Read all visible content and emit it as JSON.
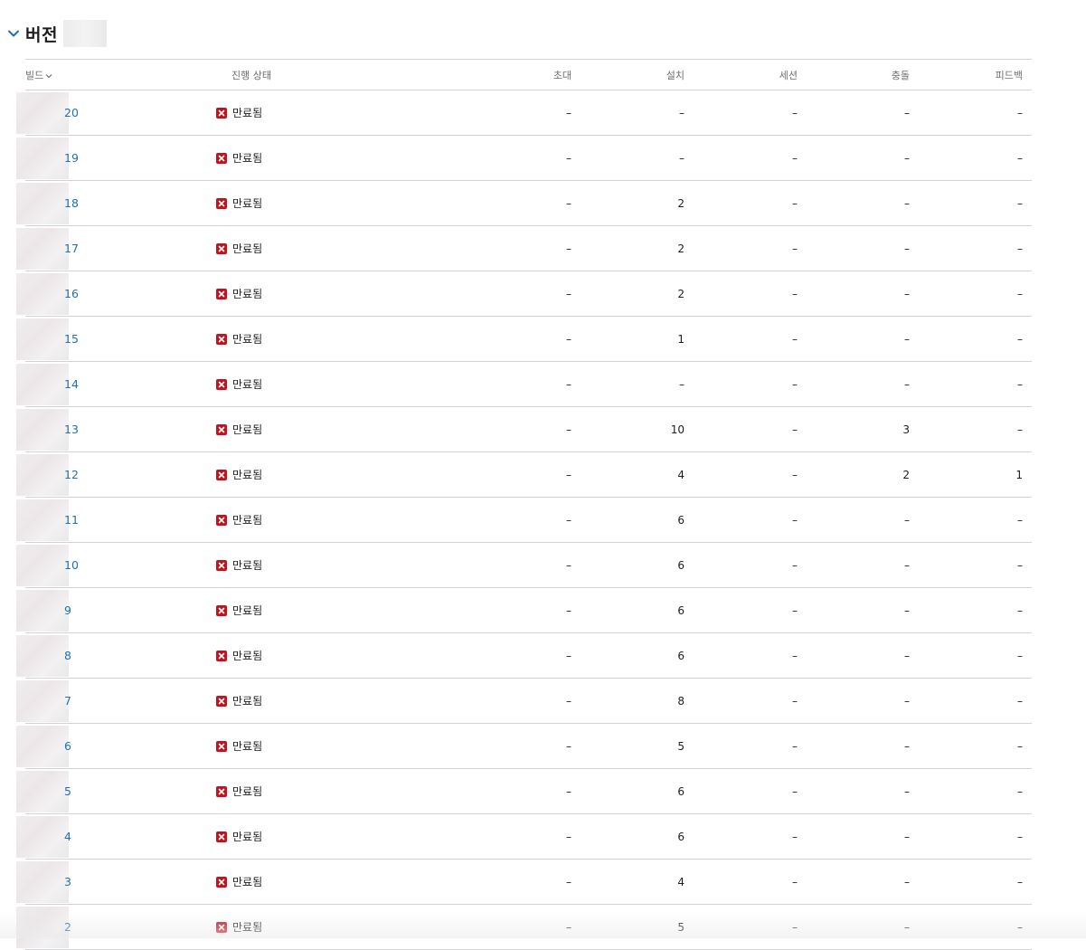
{
  "section": {
    "title": "버전"
  },
  "columns": {
    "build": "빌드",
    "status": "진행 상태",
    "invites": "초대",
    "installs": "설치",
    "sessions": "세션",
    "crashes": "충돌",
    "feedback": "피드백"
  },
  "rows": [
    {
      "build": "20",
      "status": "만료됨",
      "invites": "–",
      "installs": "–",
      "sessions": "–",
      "crashes": "–",
      "feedback": "–"
    },
    {
      "build": "19",
      "status": "만료됨",
      "invites": "–",
      "installs": "–",
      "sessions": "–",
      "crashes": "–",
      "feedback": "–"
    },
    {
      "build": "18",
      "status": "만료됨",
      "invites": "–",
      "installs": "2",
      "sessions": "–",
      "crashes": "–",
      "feedback": "–"
    },
    {
      "build": "17",
      "status": "만료됨",
      "invites": "–",
      "installs": "2",
      "sessions": "–",
      "crashes": "–",
      "feedback": "–"
    },
    {
      "build": "16",
      "status": "만료됨",
      "invites": "–",
      "installs": "2",
      "sessions": "–",
      "crashes": "–",
      "feedback": "–"
    },
    {
      "build": "15",
      "status": "만료됨",
      "invites": "–",
      "installs": "1",
      "sessions": "–",
      "crashes": "–",
      "feedback": "–"
    },
    {
      "build": "14",
      "status": "만료됨",
      "invites": "–",
      "installs": "–",
      "sessions": "–",
      "crashes": "–",
      "feedback": "–"
    },
    {
      "build": "13",
      "status": "만료됨",
      "invites": "–",
      "installs": "10",
      "sessions": "–",
      "crashes": "3",
      "feedback": "–"
    },
    {
      "build": "12",
      "status": "만료됨",
      "invites": "–",
      "installs": "4",
      "sessions": "–",
      "crashes": "2",
      "feedback": "1"
    },
    {
      "build": "11",
      "status": "만료됨",
      "invites": "–",
      "installs": "6",
      "sessions": "–",
      "crashes": "–",
      "feedback": "–"
    },
    {
      "build": "10",
      "status": "만료됨",
      "invites": "–",
      "installs": "6",
      "sessions": "–",
      "crashes": "–",
      "feedback": "–"
    },
    {
      "build": "9",
      "status": "만료됨",
      "invites": "–",
      "installs": "6",
      "sessions": "–",
      "crashes": "–",
      "feedback": "–"
    },
    {
      "build": "8",
      "status": "만료됨",
      "invites": "–",
      "installs": "6",
      "sessions": "–",
      "crashes": "–",
      "feedback": "–"
    },
    {
      "build": "7",
      "status": "만료됨",
      "invites": "–",
      "installs": "8",
      "sessions": "–",
      "crashes": "–",
      "feedback": "–"
    },
    {
      "build": "6",
      "status": "만료됨",
      "invites": "–",
      "installs": "5",
      "sessions": "–",
      "crashes": "–",
      "feedback": "–"
    },
    {
      "build": "5",
      "status": "만료됨",
      "invites": "–",
      "installs": "6",
      "sessions": "–",
      "crashes": "–",
      "feedback": "–"
    },
    {
      "build": "4",
      "status": "만료됨",
      "invites": "–",
      "installs": "6",
      "sessions": "–",
      "crashes": "–",
      "feedback": "–"
    },
    {
      "build": "3",
      "status": "만료됨",
      "invites": "–",
      "installs": "4",
      "sessions": "–",
      "crashes": "–",
      "feedback": "–"
    },
    {
      "build": "2",
      "status": "만료됨",
      "invites": "–",
      "installs": "5",
      "sessions": "–",
      "crashes": "–",
      "feedback": "–"
    }
  ],
  "colors": {
    "link": "#1f6fb5",
    "expired": "#c1121f",
    "divider": "#d2d2d7"
  },
  "icons": {
    "section_toggle": "chevron-down-icon",
    "sort": "chevron-down-icon",
    "status": "close-icon"
  }
}
